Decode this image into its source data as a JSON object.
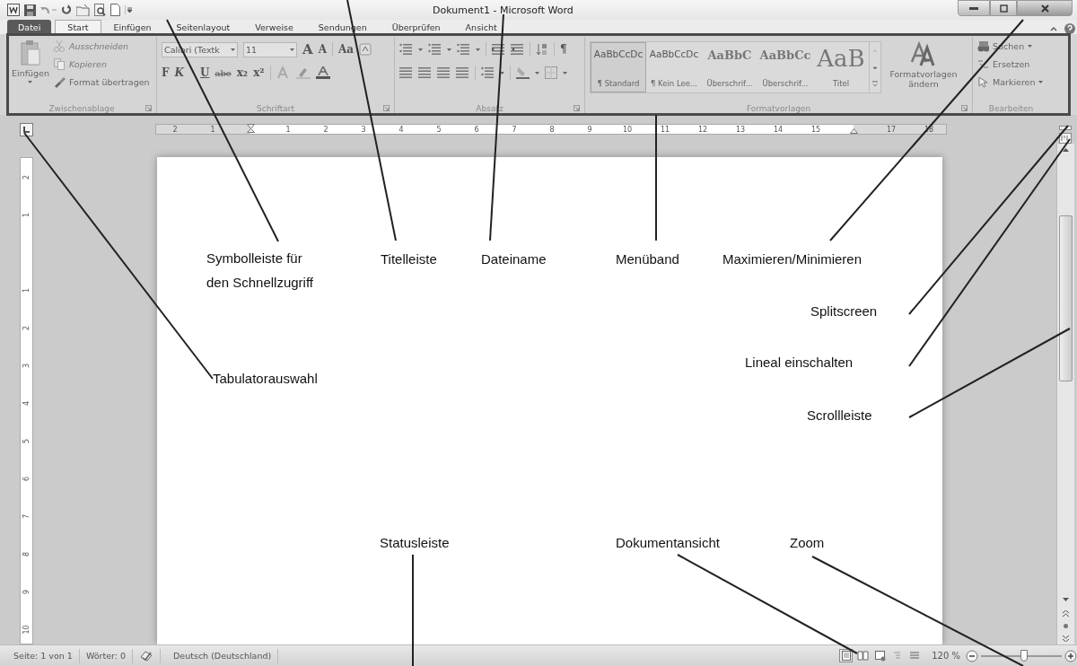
{
  "window": {
    "title": "Dokument1 - Microsoft Word"
  },
  "tabs": [
    {
      "label": "Datei",
      "kind": "file",
      "selected": false
    },
    {
      "label": "Start",
      "kind": "tab",
      "selected": true
    },
    {
      "label": "Einfügen",
      "kind": "tab",
      "selected": false
    },
    {
      "label": "Seitenlayout",
      "kind": "tab",
      "selected": false
    },
    {
      "label": "Verweise",
      "kind": "tab",
      "selected": false
    },
    {
      "label": "Sendungen",
      "kind": "tab",
      "selected": false
    },
    {
      "label": "Überprüfen",
      "kind": "tab",
      "selected": false
    },
    {
      "label": "Ansicht",
      "kind": "tab",
      "selected": false
    }
  ],
  "ribbon": {
    "clipboard": {
      "title": "Zwischenablage",
      "paste": "Einfügen",
      "commands": [
        {
          "label": "Ausschneiden",
          "disabled": true
        },
        {
          "label": "Kopieren",
          "disabled": true
        },
        {
          "label": "Format übertragen",
          "disabled": false
        }
      ]
    },
    "font": {
      "title": "Schriftart",
      "font_name": "Calibri (Textk",
      "font_size": "11",
      "grow": "A",
      "shrink": "A",
      "change_case": "Aa",
      "bold": "F",
      "italic": "K",
      "underline": "U",
      "strikethrough": "abe",
      "subscript": "x₂",
      "superscript": "x²"
    },
    "paragraph": {
      "title": "Absatz",
      "show_marks": "¶"
    },
    "styles": {
      "title": "Formatvorlagen",
      "items": [
        {
          "sample": "AaBbCcDc",
          "name": "¶ Standard",
          "kind": "body",
          "selected": true
        },
        {
          "sample": "AaBbCcDc",
          "name": "¶ Kein Lee...",
          "kind": "body",
          "selected": false
        },
        {
          "sample": "AaBbC",
          "name": "Überschrif...",
          "kind": "heading",
          "selected": false
        },
        {
          "sample": "AaBbCc",
          "name": "Überschrif...",
          "kind": "heading",
          "selected": false
        },
        {
          "sample": "AaB",
          "name": "Titel",
          "kind": "title",
          "selected": false
        }
      ],
      "change": "Formatvorlagen ändern"
    },
    "editing": {
      "title": "Bearbeiten",
      "commands": [
        {
          "label": "Suchen",
          "kind": "find",
          "dropdown": true
        },
        {
          "label": "Ersetzen",
          "kind": "replace",
          "dropdown": false
        },
        {
          "label": "Markieren",
          "kind": "select",
          "dropdown": true
        }
      ]
    }
  },
  "ruler": {
    "marks": [
      {
        "kind": "number",
        "text": "2"
      },
      {
        "kind": "number",
        "text": "1"
      },
      {
        "kind": "left_indent"
      },
      {
        "kind": "number",
        "text": "1"
      },
      {
        "kind": "number",
        "text": "2"
      },
      {
        "kind": "number",
        "text": "3"
      },
      {
        "kind": "number",
        "text": "4"
      },
      {
        "kind": "number",
        "text": "5"
      },
      {
        "kind": "number",
        "text": "6"
      },
      {
        "kind": "number",
        "text": "7"
      },
      {
        "kind": "number",
        "text": "8"
      },
      {
        "kind": "number",
        "text": "9"
      },
      {
        "kind": "number",
        "text": "10"
      },
      {
        "kind": "number",
        "text": "11"
      },
      {
        "kind": "number",
        "text": "12"
      },
      {
        "kind": "number",
        "text": "13"
      },
      {
        "kind": "number",
        "text": "14"
      },
      {
        "kind": "number",
        "text": "15"
      },
      {
        "kind": "right_indent"
      },
      {
        "kind": "number",
        "text": "17"
      },
      {
        "kind": "number",
        "text": "18"
      }
    ]
  },
  "vertical_ruler": {
    "marks": [
      "2",
      "1",
      "1",
      "2",
      "3",
      "4",
      "5",
      "6",
      "7",
      "8",
      "9",
      "10"
    ]
  },
  "annotations": [
    {
      "text": "Symbolleiste für den Schnellzugriff"
    },
    {
      "text": "Titelleiste"
    },
    {
      "text": "Dateiname"
    },
    {
      "text": "Menüband"
    },
    {
      "text": "Maximieren/Minimieren"
    },
    {
      "text": "Splitscreen"
    },
    {
      "text": "Lineal einschalten"
    },
    {
      "text": "Tabulatorauswahl"
    },
    {
      "text": "Scrollleiste"
    },
    {
      "text": "Statusleiste"
    },
    {
      "text": "Dokumentansicht"
    },
    {
      "text": "Zoom"
    }
  ],
  "status_bar": {
    "page": "Seite: 1 von 1",
    "words": "Wörter: 0",
    "language": "Deutsch (Deutschland)",
    "views": [
      {
        "kind": "print",
        "selected": true
      },
      {
        "kind": "reading",
        "selected": false
      },
      {
        "kind": "web",
        "selected": false
      },
      {
        "kind": "outline",
        "selected": false
      },
      {
        "kind": "draft",
        "selected": false
      }
    ],
    "zoom": "120 %",
    "zoom_slider": {
      "level": 0.53
    }
  }
}
